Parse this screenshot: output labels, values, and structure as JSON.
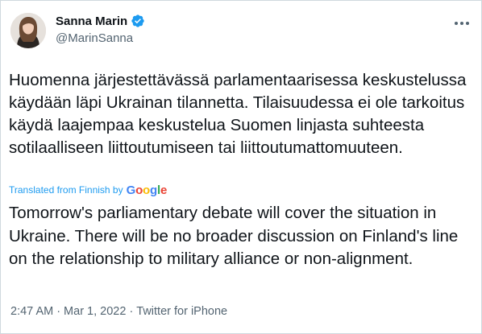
{
  "author": {
    "display_name": "Sanna Marin",
    "handle": "@MarinSanna",
    "verified": true
  },
  "tweet": {
    "text": "Huomenna järjestettävässä parlamentaarisessa keskustelussa käydään läpi Ukrainan tilannetta. Tilaisuudessa ei ole tarkoitus käydä laajempaa keskustelua Suomen linjasta suhteesta sotilaalliseen liittoutumiseen tai liittoutumattomuuteen.",
    "translated_label": "Translated from Finnish by",
    "translation_provider": "Google",
    "translation": "Tomorrow's parliamentary debate will cover the situation in Ukraine. There will be no broader discussion on Finland's line on the relationship to military alliance or non-alignment.",
    "time": "2:47 AM",
    "separator": "·",
    "date": "Mar 1, 2022",
    "source": "Twitter for iPhone"
  },
  "icons": {
    "avatar": "avatar-photo",
    "verified": "verified-badge-icon",
    "more": "more-options-icon"
  },
  "colors": {
    "accent": "#1d9bf0",
    "text": "#0f1419",
    "muted": "#536471",
    "border": "#cfd9de"
  }
}
